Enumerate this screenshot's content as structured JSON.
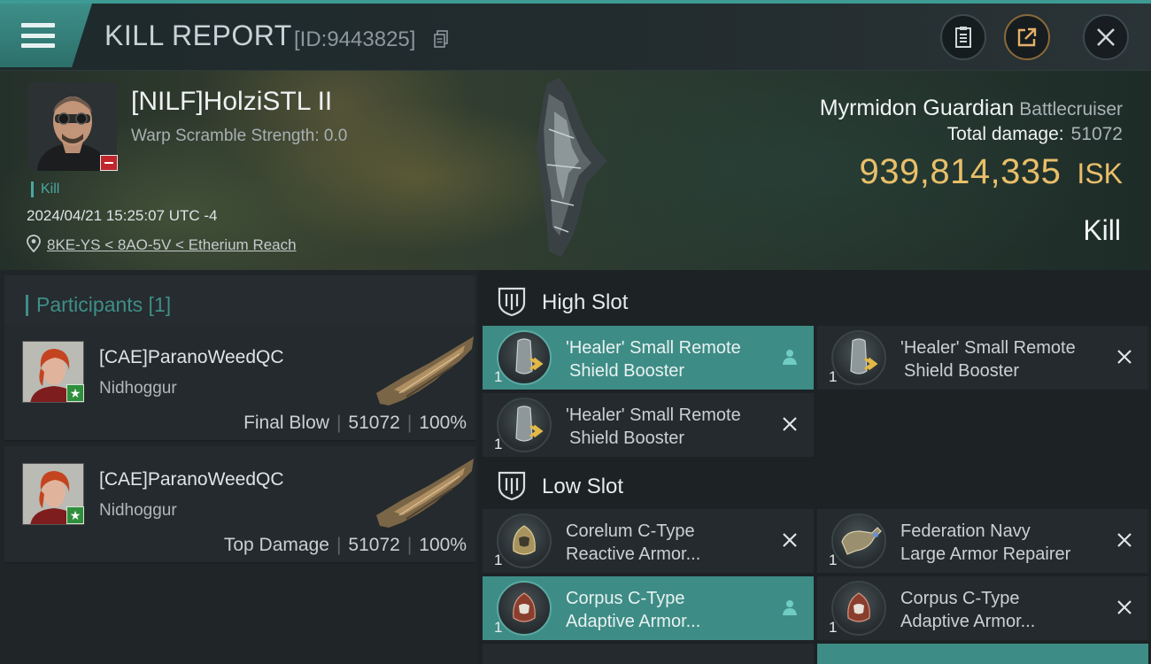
{
  "header": {
    "title": "KILL REPORT",
    "report_id": "[ID:9443825]"
  },
  "victim": {
    "name": "[NILF]HolziSTL II",
    "warp_scramble": "Warp Scramble Strength: 0.0",
    "kill_tag": "Kill",
    "datetime": "2024/04/21 15:25:07 UTC -4",
    "location": "8KE-YS < 8AO-5V < Etherium Reach",
    "ship_name": "Myrmidon Guardian",
    "ship_class": "Battlecruiser",
    "total_damage_label": "Total damage:",
    "total_damage": "51072",
    "isk_value": "939,814,335",
    "isk_unit": "ISK",
    "result": "Kill"
  },
  "participants": {
    "title": "Participants [1]",
    "rows": [
      {
        "name": "[CAE]ParanoWeedQC",
        "ship": "Nidhoggur",
        "role": "Final Blow",
        "damage": "51072",
        "percent": "100%"
      },
      {
        "name": "[CAE]ParanoWeedQC",
        "ship": "Nidhoggur",
        "role": "Top Damage",
        "damage": "51072",
        "percent": "100%"
      }
    ]
  },
  "fitting": {
    "high_slot": {
      "label": "High Slot",
      "modules": [
        {
          "line1": "'Healer' Small Remote",
          "line2": "Shield Booster",
          "qty": "1",
          "status": "pilot"
        },
        {
          "line1": "'Healer' Small Remote",
          "line2": "Shield Booster",
          "qty": "1",
          "status": "destroyed"
        },
        {
          "line1": "'Healer' Small Remote",
          "line2": "Shield Booster",
          "qty": "1",
          "status": "destroyed"
        }
      ]
    },
    "low_slot": {
      "label": "Low Slot",
      "modules": [
        {
          "line1": "Corelum C-Type",
          "line2": "Reactive Armor...",
          "qty": "1",
          "status": "destroyed"
        },
        {
          "line1": "Federation Navy",
          "line2": "Large Armor Repairer",
          "qty": "1",
          "status": "destroyed"
        },
        {
          "line1": "Corpus C-Type",
          "line2": "Adaptive Armor...",
          "qty": "1",
          "status": "pilot"
        },
        {
          "line1": "Corpus C-Type",
          "line2": "Adaptive Armor...",
          "qty": "1",
          "status": "destroyed"
        }
      ]
    }
  },
  "colors": {
    "accent_teal": "#3e8c86",
    "isk_gold": "#e8bf6a",
    "danger_red": "#c0262c",
    "badge_green": "#2f8f3c"
  }
}
